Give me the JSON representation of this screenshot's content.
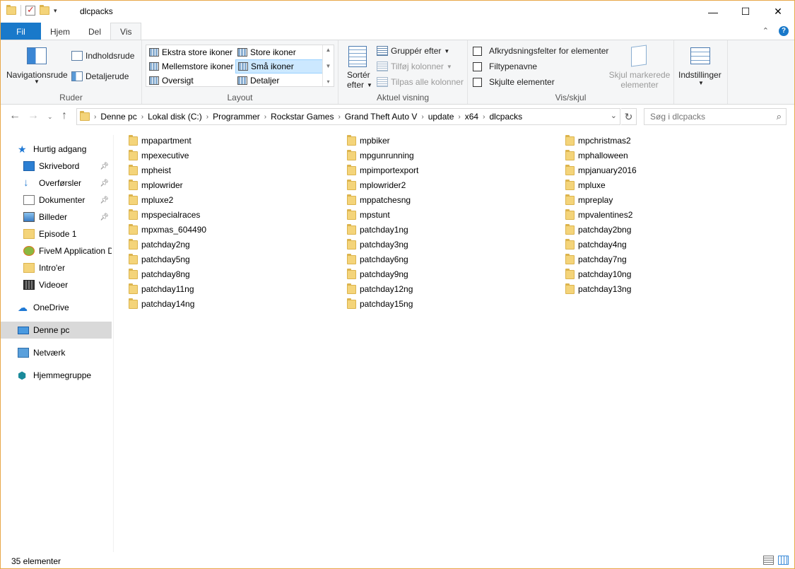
{
  "window": {
    "title": "dlcpacks"
  },
  "tabs": {
    "file": "Fil",
    "home": "Hjem",
    "share": "Del",
    "view": "Vis"
  },
  "ribbon": {
    "panes": {
      "label": "Ruder",
      "navigation_pane": "Navigationsrude",
      "preview_pane": "Indholdsrude",
      "details_pane": "Detaljerude"
    },
    "layout": {
      "label": "Layout",
      "extra_large": "Ekstra store ikoner",
      "large": "Store ikoner",
      "medium": "Mellemstore ikoner",
      "small": "Små ikoner",
      "list": "Oversigt",
      "details": "Detaljer"
    },
    "current_view": {
      "label": "Aktuel visning",
      "sort_by_1": "Sortér",
      "sort_by_2": "efter",
      "group_by": "Gruppér efter",
      "add_columns": "Tilføj kolonner",
      "fit_columns": "Tilpas alle kolonner"
    },
    "show_hide": {
      "label": "Vis/skjul",
      "item_checkboxes": "Afkrydsningsfelter for elementer",
      "file_extensions": "Filtypenavne",
      "hidden_items": "Skjulte elementer",
      "hide_selected_1": "Skjul markerede",
      "hide_selected_2": "elementer"
    },
    "options": {
      "label": "Indstillinger"
    }
  },
  "address": {
    "breadcrumbs": [
      "Denne pc",
      "Lokal disk (C:)",
      "Programmer",
      "Rockstar Games",
      "Grand Theft Auto V",
      "update",
      "x64",
      "dlcpacks"
    ],
    "search_placeholder": "Søg i dlcpacks"
  },
  "sidebar": {
    "items": [
      {
        "label": "Hurtig adgang",
        "icon": "star-icon"
      },
      {
        "label": "Skrivebord",
        "icon": "desktop-icon",
        "pinned": true
      },
      {
        "label": "Overførsler",
        "icon": "download-icon",
        "pinned": true
      },
      {
        "label": "Dokumenter",
        "icon": "document-icon",
        "pinned": true
      },
      {
        "label": "Billeder",
        "icon": "pictures-icon",
        "pinned": true
      },
      {
        "label": "Episode 1",
        "icon": "folder-icon"
      },
      {
        "label": "FiveM Application D",
        "icon": "fivem-icon"
      },
      {
        "label": "Intro'er",
        "icon": "folder-icon"
      },
      {
        "label": "Videoer",
        "icon": "video-icon"
      },
      {
        "label": "OneDrive",
        "icon": "cloud-icon"
      },
      {
        "label": "Denne pc",
        "icon": "pc-icon",
        "selected": true
      },
      {
        "label": "Netværk",
        "icon": "network-icon"
      },
      {
        "label": "Hjemmegruppe",
        "icon": "homegroup-icon"
      }
    ]
  },
  "files": {
    "col1": [
      "mpapartment",
      "mpexecutive",
      "mpheist",
      "mplowrider",
      "mpluxe2",
      "mpspecialraces",
      "mpxmas_604490",
      "patchday2ng",
      "patchday5ng",
      "patchday8ng",
      "patchday11ng",
      "patchday14ng"
    ],
    "col2": [
      "mpbiker",
      "mpgunrunning",
      "mpimportexport",
      "mplowrider2",
      "mppatchesng",
      "mpstunt",
      "patchday1ng",
      "patchday3ng",
      "patchday6ng",
      "patchday9ng",
      "patchday12ng",
      "patchday15ng"
    ],
    "col3": [
      "mpchristmas2",
      "mphalloween",
      "mpjanuary2016",
      "mpluxe",
      "mpreplay",
      "mpvalentines2",
      "patchday2bng",
      "patchday4ng",
      "patchday7ng",
      "patchday10ng",
      "patchday13ng"
    ]
  },
  "status": {
    "count": "35 elementer"
  },
  "colors": {
    "accent": "#1979ca",
    "folder": "#f4d47a",
    "selection": "#cce8ff"
  }
}
